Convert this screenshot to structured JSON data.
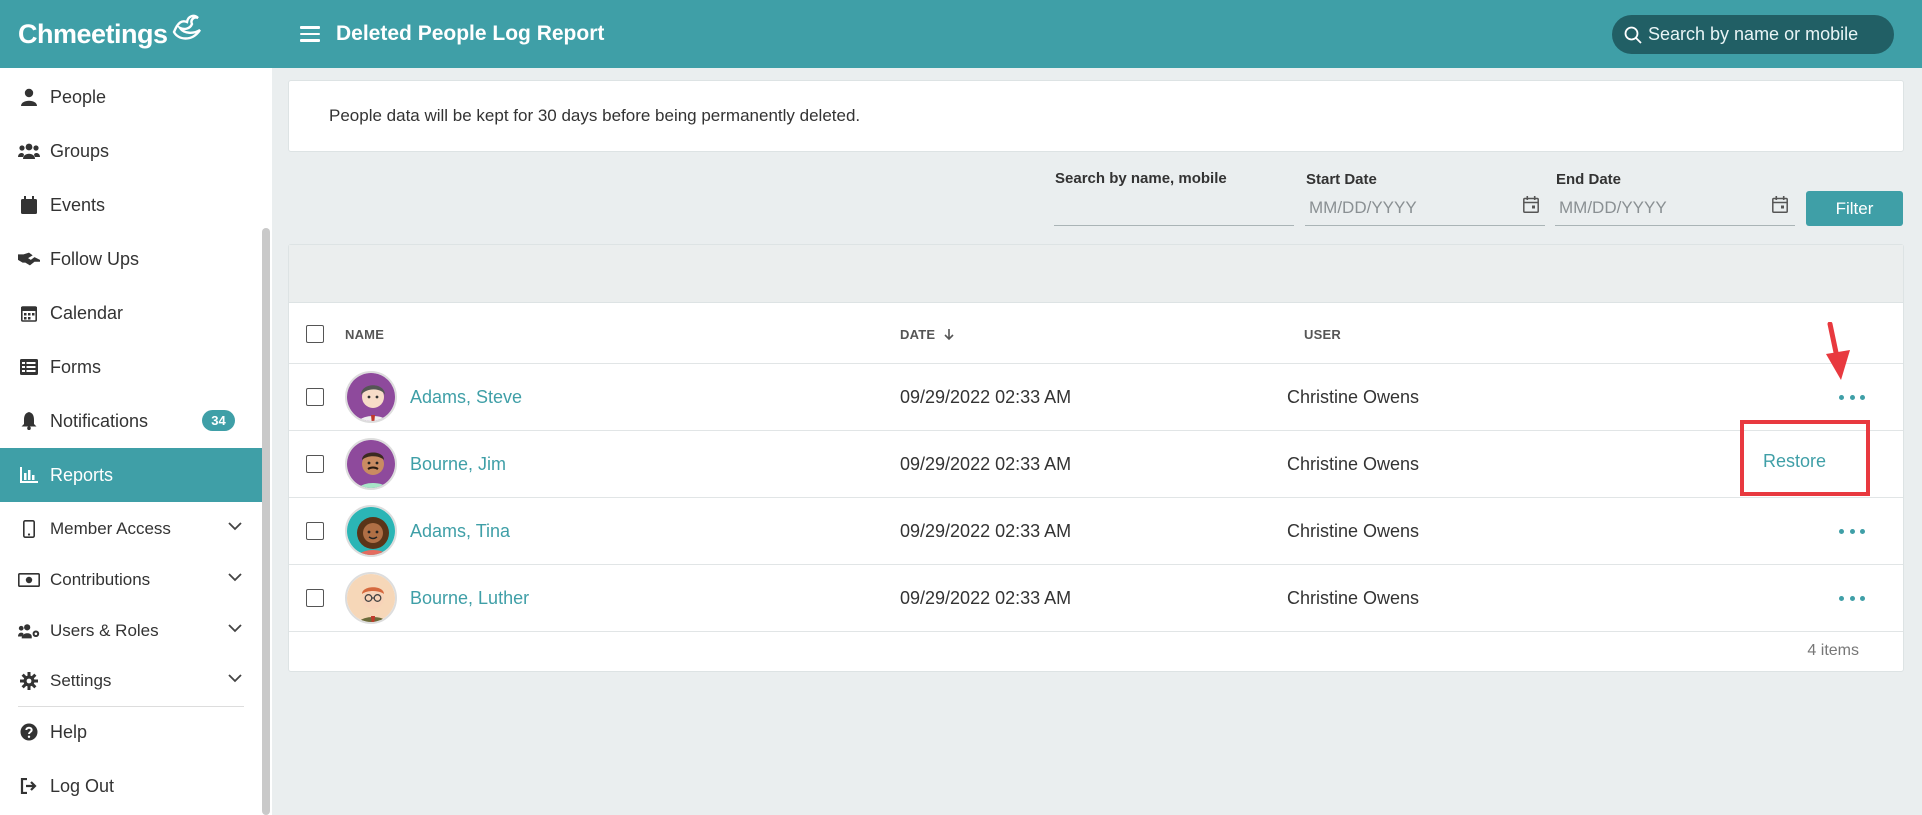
{
  "brand": {
    "name": "Chmeetings"
  },
  "header": {
    "title": "Deleted People Log Report",
    "search_placeholder": "Search by name or mobile"
  },
  "sidebar": {
    "items": [
      {
        "label": "People",
        "icon": "person-icon"
      },
      {
        "label": "Groups",
        "icon": "users-icon"
      },
      {
        "label": "Events",
        "icon": "calendar-icon"
      },
      {
        "label": "Follow Ups",
        "icon": "handshake-icon"
      },
      {
        "label": "Calendar",
        "icon": "calendar-grid-icon"
      },
      {
        "label": "Forms",
        "icon": "list-icon"
      },
      {
        "label": "Notifications",
        "icon": "bell-icon",
        "badge": "34"
      },
      {
        "label": "Reports",
        "icon": "bar-chart-icon",
        "active": true
      },
      {
        "label": "Member Access",
        "icon": "mobile-icon"
      },
      {
        "label": "Contributions",
        "icon": "money-icon"
      },
      {
        "label": "Users & Roles",
        "icon": "users-cog-icon"
      },
      {
        "label": "Settings",
        "icon": "gear-icon"
      },
      {
        "label": "Help",
        "icon": "question-icon"
      },
      {
        "label": "Log Out",
        "icon": "logout-icon"
      }
    ]
  },
  "notice": {
    "text": "People data will be kept for 30 days before being permanently deleted."
  },
  "filters": {
    "search_label": "Search by name, mobile",
    "search_value": "",
    "start_label": "Start Date",
    "start_placeholder": "MM/DD/YYYY",
    "end_label": "End Date",
    "end_placeholder": "MM/DD/YYYY",
    "filter_button": "Filter"
  },
  "table": {
    "columns": {
      "name": "NAME",
      "date": "DATE",
      "user": "USER"
    },
    "rows": [
      {
        "name": "Adams, Steve",
        "date": "09/29/2022 02:33 AM",
        "user": "Christine Owens"
      },
      {
        "name": "Bourne, Jim",
        "date": "09/29/2022 02:33 AM",
        "user": "Christine Owens",
        "action": "Restore"
      },
      {
        "name": "Adams, Tina",
        "date": "09/29/2022 02:33 AM",
        "user": "Christine Owens"
      },
      {
        "name": "Bourne, Luther",
        "date": "09/29/2022 02:33 AM",
        "user": "Christine Owens"
      }
    ],
    "footer": "4 items"
  },
  "colors": {
    "accent": "#3f9fa7",
    "header_search": "#215f65",
    "annotation": "#e8393f"
  }
}
